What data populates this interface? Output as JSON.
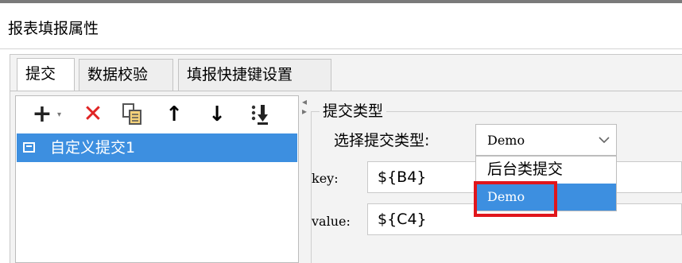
{
  "dialog": {
    "title": "报表填报属性"
  },
  "tabs": [
    {
      "label": "提交",
      "active": true
    },
    {
      "label": "数据校验",
      "active": false
    },
    {
      "label": "填报快捷键设置",
      "active": false
    }
  ],
  "toolbar": {
    "add_icon": "plus-icon",
    "delete_icon": "delete-x-icon",
    "copy_icon": "copy-icon",
    "move_up_icon": "arrow-up-icon",
    "move_down_icon": "arrow-down-icon",
    "move_to_end_icon": "move-to-end-icon",
    "add_glyph": "+",
    "add_caret": "▾",
    "delete_glyph": "✕",
    "copy_glyph": "⧉",
    "up_glyph": "↑",
    "down_glyph": "↓",
    "moveend_glyph": "⁝⬇"
  },
  "list": {
    "items": [
      {
        "label": "自定义提交1",
        "selected": true
      }
    ]
  },
  "submit_type": {
    "group_title": "提交类型",
    "label": "选择提交类型:",
    "selected": "Demo",
    "options": [
      "后台类提交",
      "Demo"
    ],
    "highlighted_option": "Demo"
  },
  "params": {
    "key_label": "key:",
    "key_value": "${B4}",
    "value_label": "value:",
    "value_value": "${C4}"
  },
  "colors": {
    "selection_blue": "#3d8fe0",
    "delete_red": "#e02424",
    "highlight_red": "#e0161c"
  }
}
